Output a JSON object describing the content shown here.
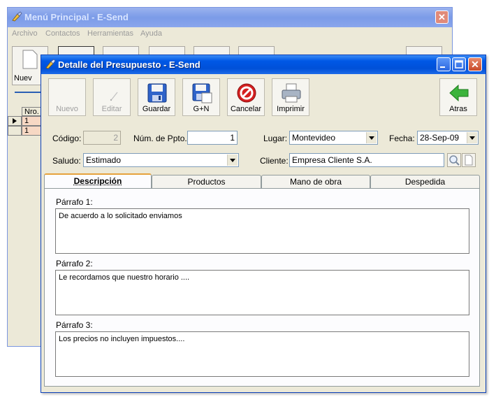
{
  "background_window": {
    "title": "Menú Principal - E-Send",
    "menu": [
      "Archivo",
      "Contactos",
      "Herramientas",
      "Ayuda"
    ],
    "toolbar_first_label": "Nuev",
    "grid": {
      "header": "Nro.",
      "rows": [
        "1",
        "1"
      ]
    }
  },
  "dialog": {
    "title": "Detalle del Presupuesto - E-Send",
    "toolbar": {
      "nuevo": "Nuevo",
      "editar": "Editar",
      "guardar": "Guardar",
      "gn": "G+N",
      "cancelar": "Cancelar",
      "imprimir": "Imprimir",
      "atras": "Atras"
    },
    "form": {
      "codigo_label": "Código:",
      "codigo_value": "2",
      "num_pto_label": "Núm. de Ppto.:",
      "num_pto_value": "1",
      "lugar_label": "Lugar:",
      "lugar_value": "Montevideo",
      "fecha_label": "Fecha:",
      "fecha_value": "28-Sep-09",
      "saludo_label": "Saludo:",
      "saludo_value": "Estimado",
      "cliente_label": "Cliente:",
      "cliente_value": "Empresa Cliente S.A."
    },
    "tabs": [
      "Descripción",
      "Productos",
      "Mano de obra",
      "Despedida"
    ],
    "active_tab": "Descripción",
    "paragraphs": [
      {
        "label": "Párrafo 1:",
        "text": "De acuerdo a lo solicitado enviamos"
      },
      {
        "label": "Párrafo 2:",
        "text": "Le recordamos que nuestro horario ...."
      },
      {
        "label": "Párrafo 3:",
        "text": "Los precios no incluyen impuestos...."
      }
    ]
  },
  "colors": {
    "titlebar_active": "#0054e3",
    "titlebar_inactive": "#7b9be8",
    "window_bg": "#ece9d8",
    "tab_active_accent": "#e6a23c"
  }
}
